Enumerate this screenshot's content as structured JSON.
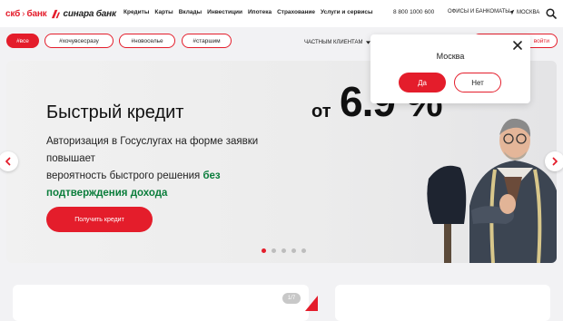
{
  "header": {
    "logo_skb": "скб",
    "logo_sep": "›",
    "logo_bank": "банк",
    "logo_sinara": "синара банк",
    "nav": [
      "Кредиты",
      "Карты",
      "Вклады",
      "Инвестиции",
      "Ипотека",
      "Страхование",
      "Услуги и сервисы"
    ],
    "phone": "8 800 1000 600",
    "offices": "ОФИСЫ И БАНКОМАТЫ",
    "city": "МОСКВА"
  },
  "tags": [
    "#все",
    "#хочувсесразу",
    "#новоселье",
    "#старшим"
  ],
  "segment": "ЧАСТНЫМ КЛИЕНТАМ",
  "login_label": "войти",
  "banner": {
    "title": "Быстрый кредит",
    "desc_1": "Авторизация в Госуслугах на форме заявки повышает",
    "desc_2": "вероятность быстрого решения",
    "desc_green": "без подтверждения дохода",
    "button": "Получить кредит",
    "rate_prefix": "от",
    "rate_value": "6.9 %",
    "slides_total": 5,
    "slide_active": 1
  },
  "card_badge": "1/7",
  "popup": {
    "city": "Москва",
    "yes": "Да",
    "no": "Нет"
  },
  "colors": {
    "brand_red": "#e41d2b",
    "green": "#0a7d3b"
  }
}
